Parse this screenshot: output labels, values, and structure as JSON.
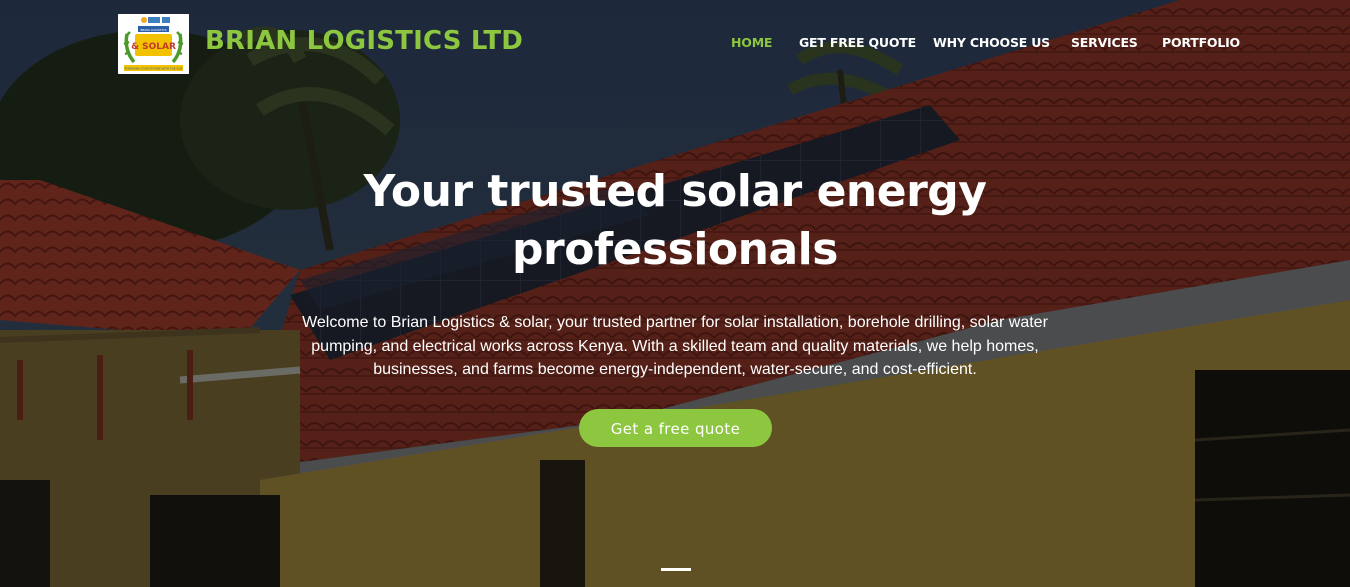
{
  "brand": {
    "name": "BRIAN LOGISTICS LTD",
    "color": "#8dc63f",
    "logo": {
      "top_text": "BRIAN LOGISTICS",
      "main_text": "& SOLAR",
      "bottom_text": "POWERING YOUR FUTURE WITH THE SUN"
    }
  },
  "nav": {
    "items": [
      {
        "label": "HOME",
        "active": true
      },
      {
        "label": "GET FREE QUOTE",
        "active": false
      },
      {
        "label": "WHY CHOOSE US",
        "active": false
      },
      {
        "label": "SERVICES",
        "active": false
      },
      {
        "label": "PORTFOLIO",
        "active": false
      }
    ]
  },
  "hero": {
    "headline_line1": "Your trusted solar energy",
    "headline_line2": "professionals",
    "lead": "Welcome to Brian Logistics & solar, your trusted partner for solar installation, borehole drilling, solar water pumping, and electrical works across Kenya. With a skilled team and quality materials, we help homes, businesses, and farms become energy-independent, water-secure, and cost-efficient.",
    "cta_label": "Get a free quote",
    "background": "house-with-solar-panels-on-red-tile-roof"
  },
  "carousel": {
    "active_slide": 1
  }
}
